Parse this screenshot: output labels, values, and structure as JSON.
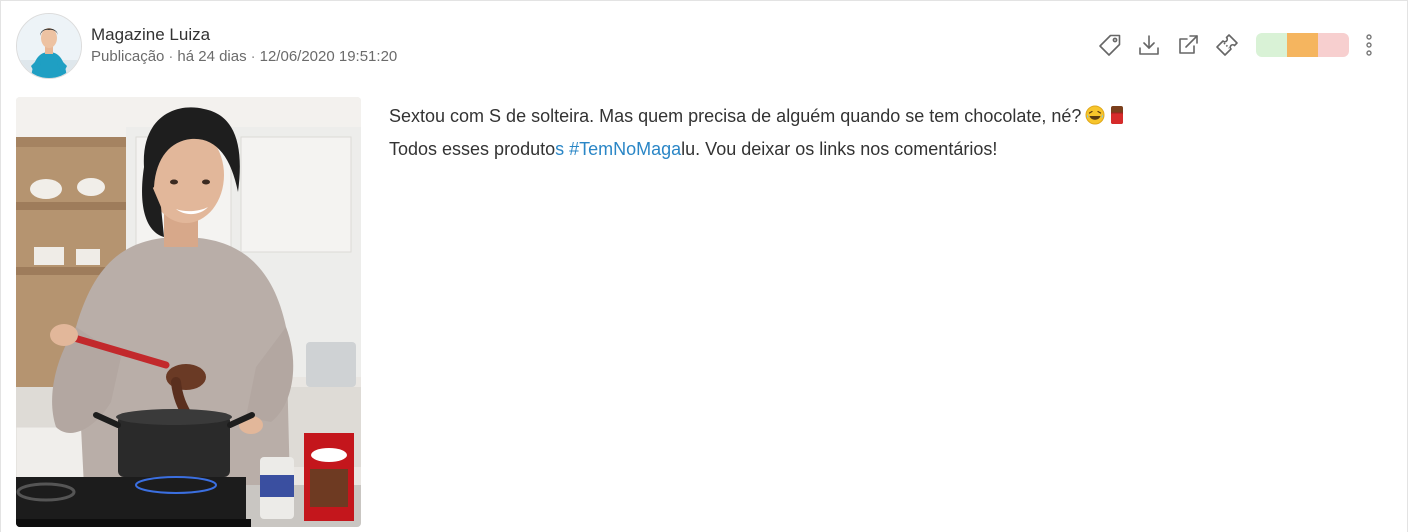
{
  "post": {
    "author": "Magazine Luiza",
    "type": "Publicação",
    "relative_time": "há 24 dias",
    "datetime": "12/06/2020 19:51:20",
    "line1": "Sextou com S de solteira. Mas quem precisa de alguém quando se tem chocolate, né?",
    "line2_before": "Todos esses produto",
    "line2_hashtag": "s #TemNoMaga",
    "line2_after": "lu. Vou deixar os links nos comentários!"
  },
  "actions": {
    "icons": [
      "tag-icon",
      "download-icon",
      "external-link-icon",
      "ticket-icon",
      "more-vertical-icon"
    ],
    "sentiment_colors": {
      "positive": "#d9f2d6",
      "neutral": "#f5b55f",
      "negative": "#f7cfcf"
    },
    "accent": "#2a86c6"
  }
}
